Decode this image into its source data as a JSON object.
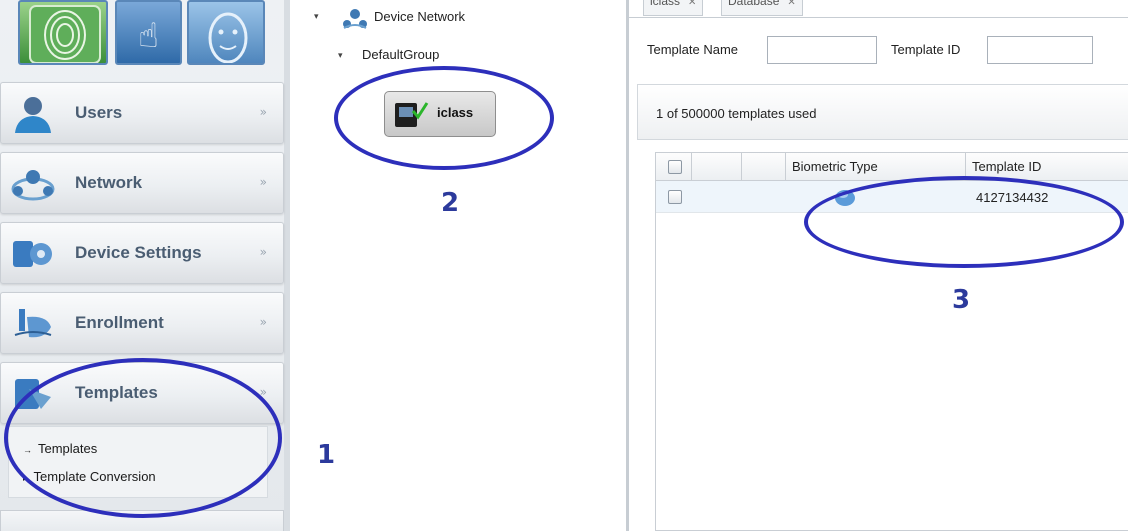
{
  "nav": {
    "tiles": [
      "fingerprint-icon",
      "touch-hand-icon",
      "face-icon"
    ],
    "items": [
      {
        "label": "Users",
        "icon": "user-icon"
      },
      {
        "label": "Network",
        "icon": "network-icon"
      },
      {
        "label": "Device Settings",
        "icon": "device-settings-icon"
      },
      {
        "label": "Enrollment",
        "icon": "enrollment-icon"
      },
      {
        "label": "Templates",
        "icon": "templates-icon"
      }
    ],
    "templates_submenu": [
      {
        "label": "Templates",
        "arrow": "→"
      },
      {
        "label": "Template Conversion",
        "arrow": "▸"
      }
    ],
    "chevron": "»"
  },
  "tree": {
    "root_label": "Device Network",
    "group_label": "DefaultGroup",
    "device_label": "iclass",
    "toggle_glyph": "▾"
  },
  "content": {
    "tabs": [
      {
        "label": "iclass",
        "close": "✕"
      },
      {
        "label": "Database",
        "close": "✕"
      }
    ],
    "filters": {
      "template_name_label": "Template Name",
      "template_name_value": "",
      "template_id_label": "Template ID",
      "template_id_value": ""
    },
    "status": "1  of 500000 templates used",
    "grid": {
      "columns": [
        "",
        "",
        "",
        "Biometric Type",
        "Template ID"
      ],
      "rows": [
        {
          "biometric_type_icon": "fingerprint-template-icon",
          "template_id": "4127134432"
        }
      ]
    }
  },
  "annotations": [
    "1",
    "2",
    "3"
  ],
  "colors": {
    "annotation": "#2c3a9c",
    "ellipse": "#2d2fbb",
    "nav_label": "#4a5d72"
  }
}
